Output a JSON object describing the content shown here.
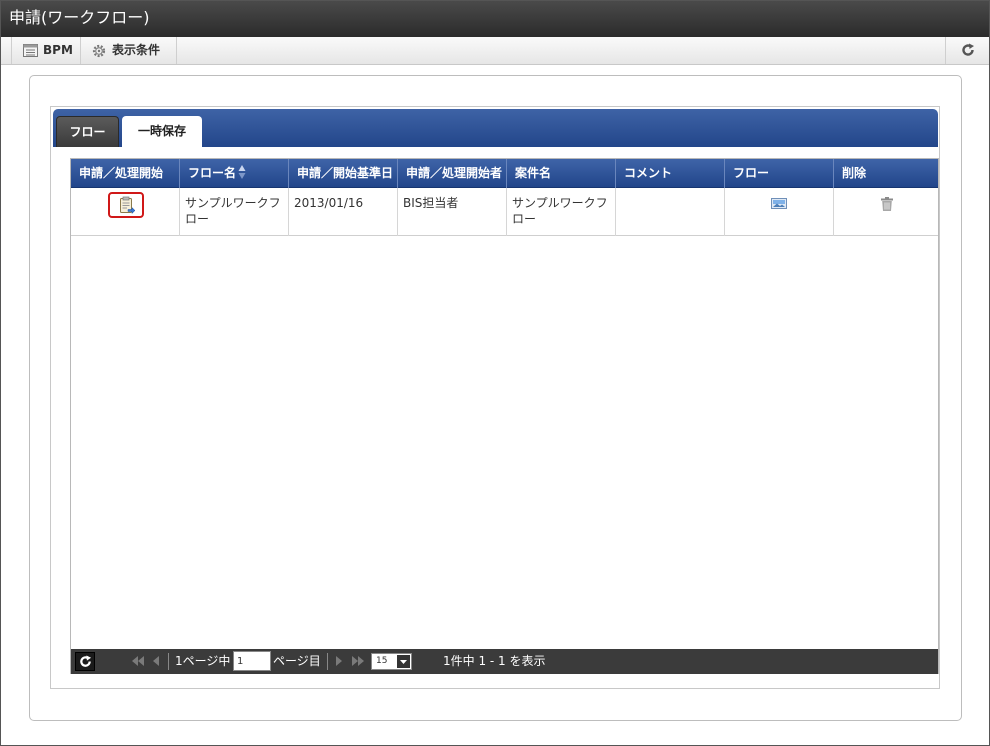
{
  "window": {
    "title": "申請(ワークフロー)"
  },
  "toolbar": {
    "bpm_label": "BPM",
    "conditions_label": "表示条件"
  },
  "tabs": [
    {
      "label": "フロー",
      "active": false
    },
    {
      "label": "一時保存",
      "active": true
    }
  ],
  "grid": {
    "columns": [
      "申請／処理開始",
      "フロー名",
      "申請／開始基準日",
      "申請／処理開始者",
      "案件名",
      "コメント",
      "フロー",
      "削除"
    ],
    "rows": [
      {
        "flow_name": "サンプルワークフロー",
        "base_date": "2013/01/16",
        "starter": "BIS担当者",
        "case_name": "サンプルワークフロー",
        "comment": ""
      }
    ]
  },
  "pager": {
    "page_prefix": "1ページ中",
    "page_value": "1",
    "page_suffix": "ページ目",
    "page_size": "15",
    "summary": "1件中 1 - 1 を表示"
  },
  "icons": {
    "toolbar_bpm": "list-icon",
    "toolbar_conditions": "gear-icon",
    "toolbar_refresh": "refresh-icon",
    "start": "clipboard-arrow-icon",
    "flow": "image-icon",
    "delete": "trash-icon"
  },
  "colors": {
    "header_blue": "#2c4f93",
    "start_highlight": "#d01818",
    "pager_bg": "#3b3b3b"
  }
}
